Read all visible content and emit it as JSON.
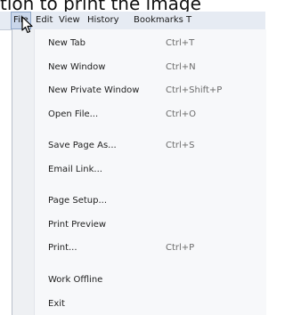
{
  "caption": "tion to print the image",
  "menubar": {
    "items": [
      {
        "label": "File"
      },
      {
        "label": "Edit"
      },
      {
        "label": "View"
      },
      {
        "label": "History"
      },
      {
        "label": "Bookmarks"
      },
      {
        "label": "T"
      }
    ]
  },
  "file_menu": {
    "items": [
      {
        "label": "New Tab",
        "shortcut": "Ctrl+T"
      },
      {
        "label": "New Window",
        "shortcut": "Ctrl+N"
      },
      {
        "label": "New Private Window",
        "shortcut": "Ctrl+Shift+P"
      },
      {
        "label": "Open File...",
        "shortcut": "Ctrl+O"
      },
      {
        "label": "Save Page As...",
        "shortcut": "Ctrl+S"
      },
      {
        "label": "Email Link...",
        "shortcut": ""
      },
      {
        "label": "Page Setup...",
        "shortcut": ""
      },
      {
        "label": "Print Preview",
        "shortcut": ""
      },
      {
        "label": "Print...",
        "shortcut": "Ctrl+P"
      },
      {
        "label": "Work Offline",
        "shortcut": ""
      },
      {
        "label": "Exit",
        "shortcut": ""
      }
    ]
  }
}
